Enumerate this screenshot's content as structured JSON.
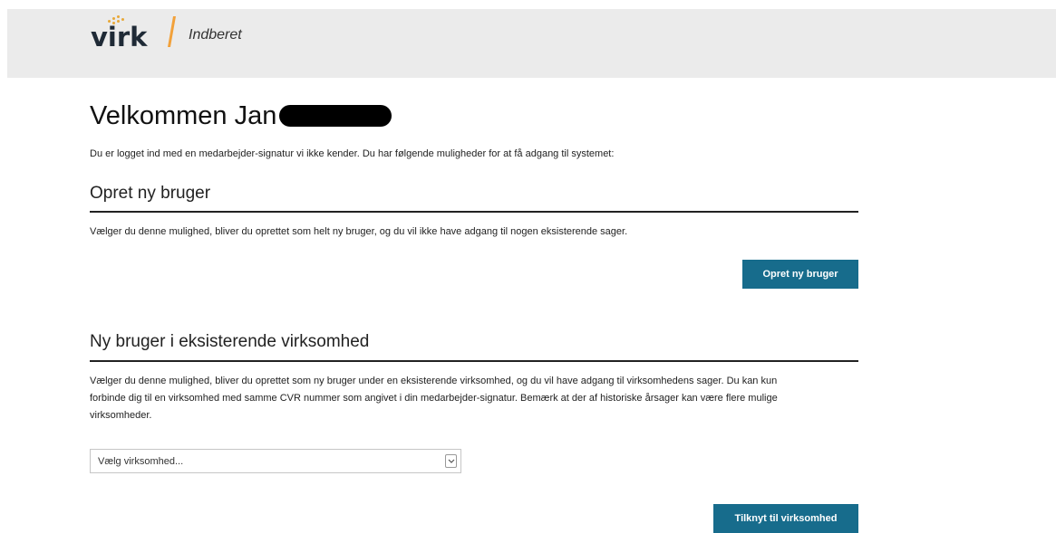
{
  "header": {
    "logo_text": "virk",
    "app_name": "Indberet"
  },
  "welcome": {
    "title": "Velkommen Jan",
    "intro": "Du er logget ind med en medarbejder-signatur vi ikke kender. Du har følgende muligheder for at få adgang til systemet:"
  },
  "section_new_user": {
    "heading": "Opret ny bruger",
    "description": "Vælger du denne mulighed, bliver du oprettet som helt ny bruger, og du vil ikke have adgang til nogen eksisterende sager.",
    "button_label": "Opret ny bruger"
  },
  "section_existing": {
    "heading": "Ny bruger i eksisterende virksomhed",
    "description_lines": [
      "Vælger du denne mulighed, bliver du oprettet som ny bruger under en eksisterende virksomhed, og du vil have adgang til virksomhedens sager. Du kan kun",
      "forbinde dig til en virksomhed med samme CVR nummer som angivet i din medarbejder-signatur. Bemærk at der af historiske årsager kan være flere mulige",
      "virksomheder."
    ],
    "select_value": "Vælg virksomhed...",
    "button_label": "Tilknyt til virksomhed"
  },
  "colors": {
    "button": "#176c8c",
    "logo_accent": "#f2a13a",
    "header_bg": "#ebebeb"
  },
  "icons": {
    "logo": "virk-logo",
    "dropdown": "chevron-down-icon"
  }
}
